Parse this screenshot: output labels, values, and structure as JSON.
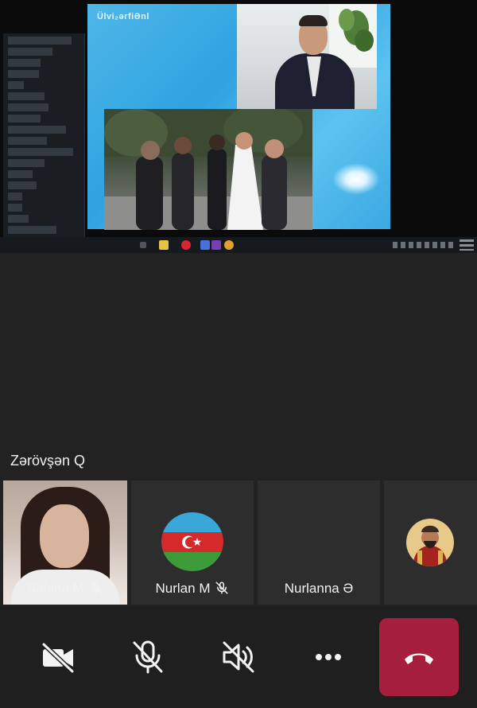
{
  "presenter": {
    "name": "Zərövşən Q"
  },
  "shared_screen": {
    "slide_title": "Ülvi₂ərfiƏnl",
    "accent": "#2ea3e0"
  },
  "participants": [
    {
      "name": "Səbinə M",
      "muted": true
    },
    {
      "name": "Nurlan M",
      "muted": true,
      "avatar": "azerbaijan-flag"
    },
    {
      "name": "Nurlanna Ə",
      "muted": false
    },
    {
      "name": "",
      "avatar": "portrait"
    }
  ],
  "controls": {
    "camera": "camera-off-icon",
    "mic": "mic-off-icon",
    "speaker": "speaker-off-icon",
    "more": "more-icon",
    "leave": "hang-up-icon",
    "leave_color": "#a61f3d"
  }
}
